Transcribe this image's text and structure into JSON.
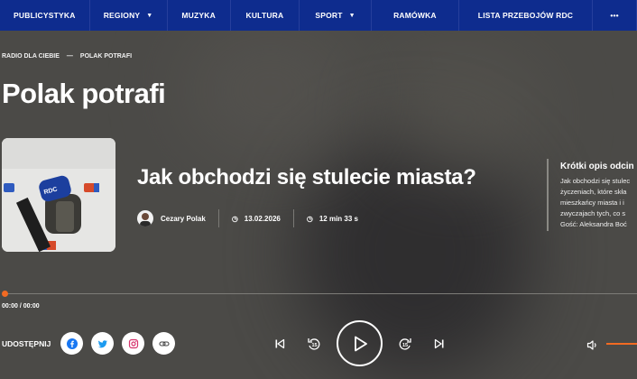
{
  "nav": {
    "items": [
      {
        "label": "PUBLICYSTYKA",
        "dropdown": false
      },
      {
        "label": "REGIONY",
        "dropdown": true
      },
      {
        "label": "MUZYKA",
        "dropdown": false
      },
      {
        "label": "KULTURA",
        "dropdown": false
      },
      {
        "label": "SPORT",
        "dropdown": true
      },
      {
        "label": "RAMÓWKA",
        "dropdown": false
      },
      {
        "label": "LISTA PRZEBOJÓW RDC",
        "dropdown": false
      }
    ],
    "more_label": "•••"
  },
  "breadcrumb": {
    "items": [
      "RADIO DLA CIEBIE",
      "POLAK POTRAFI"
    ],
    "separator": "—"
  },
  "page_title": "Polak potrafi",
  "episode": {
    "title": "Jak obchodzi się stulecie miasta?",
    "author": "Cezary Polak",
    "date": "13.02.2026",
    "duration": "12 min 33 s"
  },
  "description": {
    "title": "Krótki opis odcin",
    "lines": [
      "Jak obchodzi się stulec",
      "życzeniach, które skła",
      "mieszkańcy miasta i i",
      "zwyczajach tych, co s",
      "Gość: Aleksandra Boć"
    ]
  },
  "player": {
    "time": "00:00 / 00:00",
    "progress": 0,
    "volume": 1
  },
  "share": {
    "label": "UDOSTĘPNIJ",
    "buttons": [
      "facebook-icon",
      "twitter-icon",
      "instagram-icon",
      "link-icon"
    ]
  },
  "colors": {
    "nav_bg": "#0e2c8e",
    "accent": "#f26a22",
    "page_bg": "#4b4a47"
  }
}
